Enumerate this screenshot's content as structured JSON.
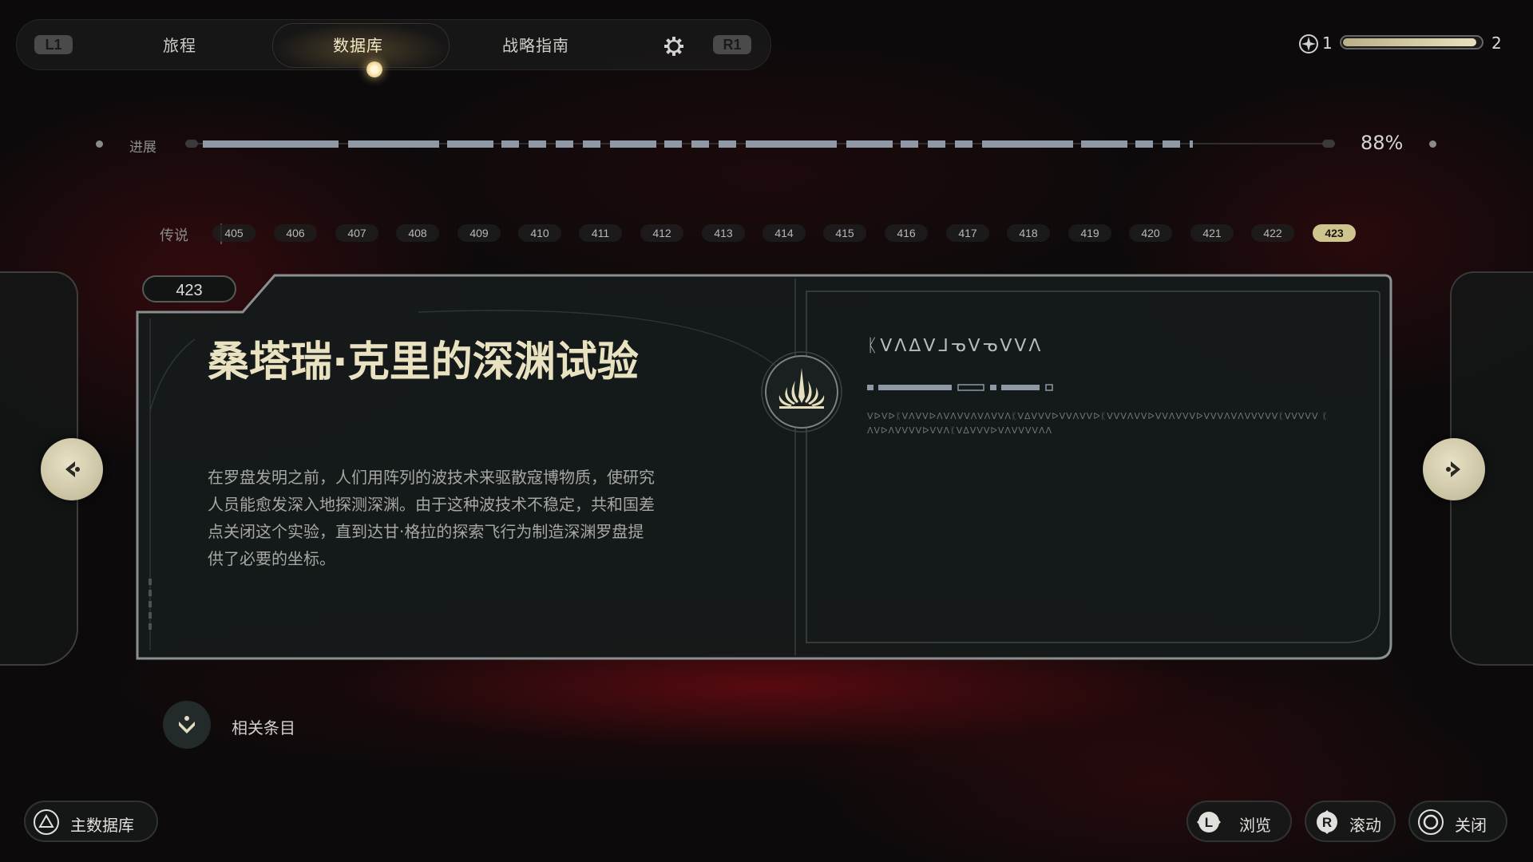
{
  "nav": {
    "left_button": "L1",
    "right_button": "R1",
    "tabs": [
      {
        "label": "旅程",
        "active": false
      },
      {
        "label": "数据库",
        "active": true
      },
      {
        "label": "战略指南",
        "active": false
      }
    ],
    "settings_icon": "gear-icon"
  },
  "status": {
    "skill_points": "1",
    "next_level": "2",
    "xp_progress": 0.97,
    "icon": "skill-point-icon"
  },
  "progress": {
    "label": "进展",
    "percent": "88%",
    "value": 0.88
  },
  "entries": {
    "category_label": "传说",
    "numbers": [
      "405",
      "406",
      "407",
      "408",
      "409",
      "410",
      "411",
      "412",
      "413",
      "414",
      "415",
      "416",
      "417",
      "418",
      "419",
      "420",
      "421",
      "422",
      "423"
    ],
    "current": "423"
  },
  "card": {
    "id": "423",
    "title": "桑塔瑞·克里的深渊试验",
    "body": "在罗盘发明之前，人们用阵列的波技术来驱散寇博物质，使研究人员能愈发深入地探测深渊。由于这种波技术不稳定，共和国差点关闭这个实验，直到达甘·格拉的探索飞行为制造深渊罗盘提供了必要的坐标。",
    "emblem_icon": "jedi-order-emblem-icon",
    "aurebesh_title": "ᛕᐯᐱᐃᐯᒧᓀᐯᓀᐯᐯᐱ",
    "aurebesh_text": "ᐯᐅᐯᐅᛕᐯᐱᐯᐯᐅᐱᐯᐱᐯᐯᐱᐯᐱᐯᐯᐱᛕᐯᐃᐯᐯᐯᐅᐯᐯᐱᐯᐯᐅᛕᐯᐯᐯᐱᐯᐯᐅᐯᐯᐱᐯᐯᐯᐅᐯᐯᐯᐱᐯᐱᐯᐯᐯᐯᐯᛕᐯᐯᐯᐯᐯ ᛕᐱᐯᐅᐱᐯᐯᐯᐯᐅᐯᐯᐱᛕᐯᐃᐯᐯᐯᐅᐯᐱᐯᐯᐯᐯᐱᐱ"
  },
  "related": {
    "label": "相关条目",
    "icon": "chevron-down-icon"
  },
  "hints": {
    "main_database": {
      "label": "主数据库",
      "glyph": "triangle-button-icon"
    },
    "browse": {
      "label": "浏览",
      "glyph": "left-stick-icon"
    },
    "scroll": {
      "label": "滚动",
      "glyph": "right-stick-icon"
    },
    "close": {
      "label": "关闭",
      "glyph": "circle-button-icon"
    }
  },
  "colors": {
    "accent": "#cfc48e",
    "title": "#e9e2c0",
    "progress_segment": "#8f99a6",
    "background_red": "#8c0a14"
  }
}
